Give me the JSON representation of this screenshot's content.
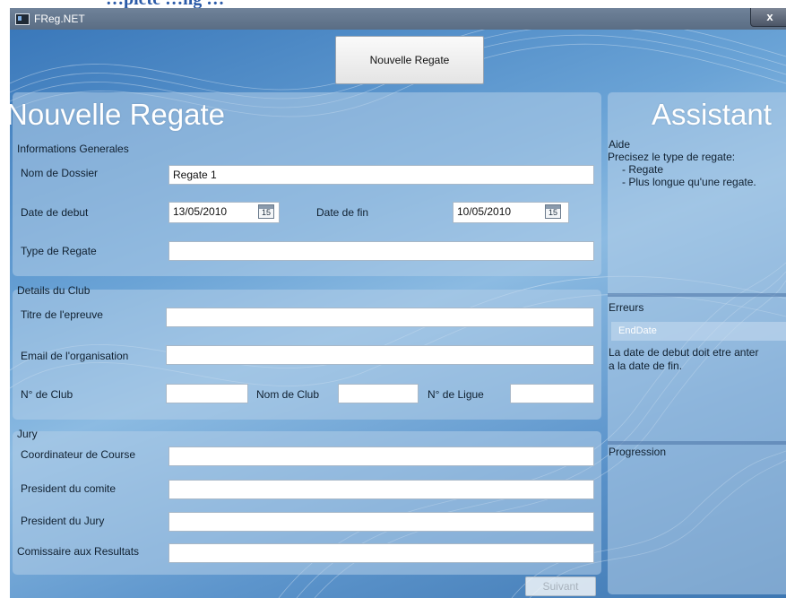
{
  "doc_heading": "…plete …ng …",
  "window": {
    "title": "FReg.NET",
    "close_label": "x"
  },
  "toolbar": {
    "new_regatta_button": "Nouvelle Regate"
  },
  "form": {
    "title": "Nouvelle Regate",
    "general": {
      "group_label": "Informations Generales",
      "folder_name_label": "Nom de Dossier",
      "folder_name_value": "Regate 1",
      "start_date_label": "Date de debut",
      "start_date_value": "13/05/2010",
      "end_date_label": "Date de fin",
      "end_date_value": "10/05/2010",
      "calendar_day": "15",
      "regatta_type_label": "Type de Regate",
      "regatta_type_value": ""
    },
    "club": {
      "group_label": "Details du Club",
      "event_title_label": "Titre de l'epreuve",
      "event_title_value": "",
      "org_email_label": "Email de l'organisation",
      "org_email_value": "",
      "club_number_label": "N° de Club",
      "club_number_value": "",
      "club_name_label": "Nom de Club",
      "club_name_value": "",
      "league_number_label": "N° de Ligue",
      "league_number_value": ""
    },
    "jury": {
      "group_label": "Jury",
      "race_coordinator_label": "Coordinateur de Course",
      "committee_president_label": "President du comite",
      "jury_president_label": "President du Jury",
      "results_commissioner_label": "Comissaire aux Resultats"
    },
    "next_button": "Suivant"
  },
  "assistant": {
    "title": "Assistant",
    "help_label": "Aide",
    "help_text": "Precisez le type de regate:",
    "help_items": [
      "- Regate",
      "- Plus longue qu'une regate."
    ],
    "errors_label": "Erreurs",
    "error_field": "EndDate",
    "error_line1": "La date de debut doit etre anter",
    "error_line2": "a la date de fin.",
    "progress_label": "Progression"
  }
}
